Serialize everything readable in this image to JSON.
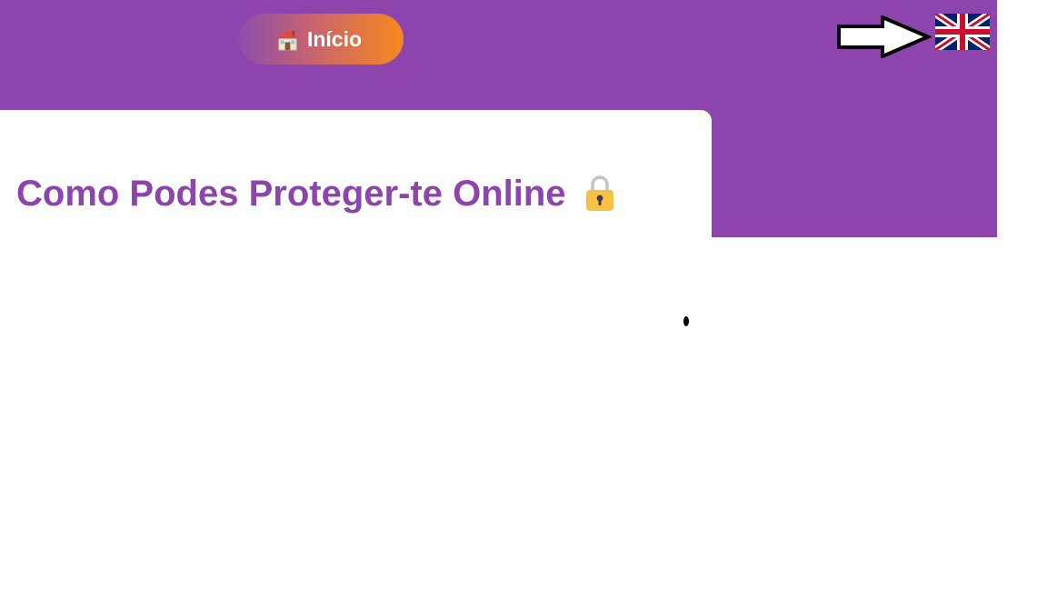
{
  "header": {
    "home_button_label": "Início",
    "home_icon": "house-icon",
    "language_flag": "uk-flag-icon",
    "annotation_arrow": "arrow-right-icon"
  },
  "main": {
    "title": "Como Podes Proteger-te Online",
    "title_icon": "lock-icon"
  },
  "colors": {
    "brand_purple": "#8e44ad",
    "button_gradient_start": "#8e4eab",
    "button_gradient_end": "#f5891c",
    "card_background": "#ffffff"
  }
}
